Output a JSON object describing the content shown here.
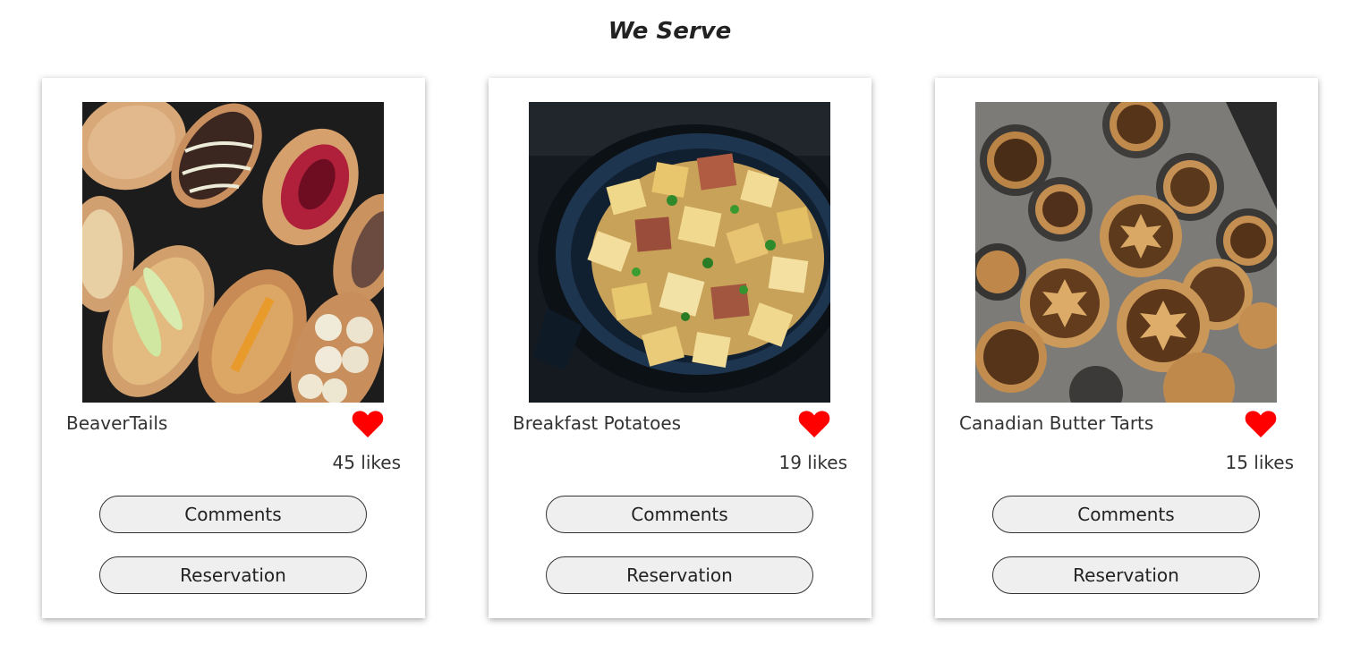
{
  "section": {
    "title": "We Serve"
  },
  "cards": [
    {
      "name": "BeaverTails",
      "likes": "45 likes",
      "comments_label": "Comments",
      "reservation_label": "Reservation",
      "image": "beavertails-photo"
    },
    {
      "name": "Breakfast Potatoes",
      "likes": "19 likes",
      "comments_label": "Comments",
      "reservation_label": "Reservation",
      "image": "breakfast-potatoes-photo"
    },
    {
      "name": "Canadian Butter Tarts",
      "likes": "15 likes",
      "comments_label": "Comments",
      "reservation_label": "Reservation",
      "image": "butter-tarts-photo"
    }
  ],
  "colors": {
    "heart": "#ff0000",
    "button_bg": "#efefef",
    "text": "#333333"
  }
}
